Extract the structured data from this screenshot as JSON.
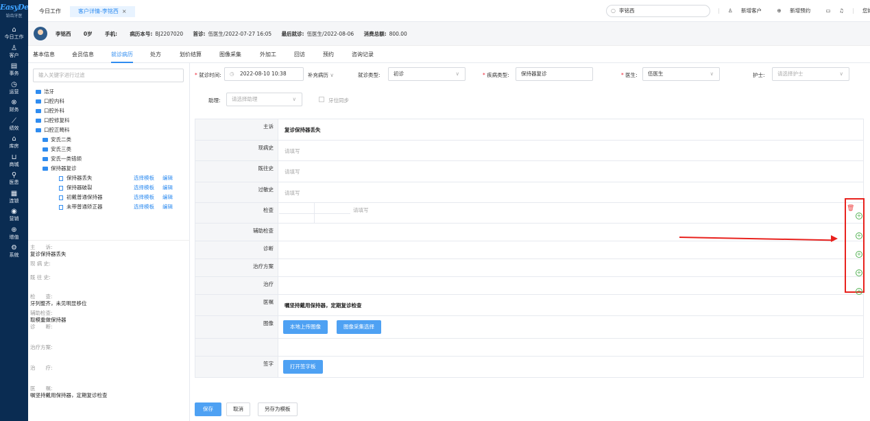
{
  "app": {
    "brand": "EasyDent",
    "brand_sub": "铂齿牙医"
  },
  "nav": [
    {
      "icon": "home-icon",
      "glyph": "⌂",
      "label": "今日工作"
    },
    {
      "icon": "customer-icon",
      "glyph": "♙",
      "label": "客户"
    },
    {
      "icon": "affairs-icon",
      "glyph": "▤",
      "label": "事务"
    },
    {
      "icon": "operation-icon",
      "glyph": "◷",
      "label": "运营"
    },
    {
      "icon": "finance-icon",
      "glyph": "⊗",
      "label": "财务"
    },
    {
      "icon": "performance-icon",
      "glyph": "⟋",
      "label": "绩效"
    },
    {
      "icon": "warehouse-icon",
      "glyph": "⌂",
      "label": "库房"
    },
    {
      "icon": "mall-icon",
      "glyph": "⊔",
      "label": "商城"
    },
    {
      "icon": "medical-icon",
      "glyph": "⚲",
      "label": "医患"
    },
    {
      "icon": "chain-icon",
      "glyph": "▦",
      "label": "连锁"
    },
    {
      "icon": "marketing-icon",
      "glyph": "◉",
      "label": "营销"
    },
    {
      "icon": "value-added-icon",
      "glyph": "⊕",
      "label": "增值"
    },
    {
      "icon": "system-icon",
      "glyph": "⚙",
      "label": "系统"
    }
  ],
  "topbar": {
    "home_tab": "今日工作",
    "active_tab": "客户详情-李铭西",
    "search_value": "李铭西",
    "new_customer": "新增客户",
    "new_appointment": "新增预约",
    "greeting": "您好，超管"
  },
  "patient": {
    "name": "李铭西",
    "age": "0岁",
    "phone_label": "手机:",
    "record_label": "病历本号:",
    "record_no": "BJ2207020",
    "first_label": "首诊:",
    "first_visit": "伍医生/2022-07-27 16:05",
    "last_label": "最后就诊:",
    "last_visit": "伍医生/2022-08-06",
    "total_label": "消费总额:",
    "total": "800.00"
  },
  "subtabs": [
    "基本信息",
    "会员信息",
    "就诊病历",
    "处方",
    "划价结算",
    "图像采集",
    "外加工",
    "回访",
    "预约",
    "咨询记录"
  ],
  "left": {
    "filter_placeholder": "输入关键字进行过滤",
    "tree": [
      {
        "type": "folder",
        "label": "洁牙",
        "indent": 0
      },
      {
        "type": "folder",
        "label": "口腔内科",
        "indent": 0
      },
      {
        "type": "folder",
        "label": "口腔外科",
        "indent": 0
      },
      {
        "type": "folder",
        "label": "口腔修复科",
        "indent": 0
      },
      {
        "type": "folder",
        "label": "口腔正畸科",
        "indent": 0
      },
      {
        "type": "folder",
        "label": "安氏二类",
        "indent": 1
      },
      {
        "type": "folder",
        "label": "安氏三类",
        "indent": 1
      },
      {
        "type": "folder",
        "label": "安氏一类错颌",
        "indent": 1
      },
      {
        "type": "folder",
        "label": "保持器复诊",
        "indent": 1
      },
      {
        "type": "file",
        "label": "保持器丢失",
        "indent": 2
      },
      {
        "type": "file",
        "label": "保持器破裂",
        "indent": 2
      },
      {
        "type": "file",
        "label": "初戴普通保持器",
        "indent": 2
      },
      {
        "type": "file",
        "label": "未带普通矫正器",
        "indent": 2
      }
    ],
    "select_template": "选择模板",
    "edit": "编辑",
    "summary": [
      {
        "label": "主　　诉:",
        "value": "复诊保持器丢失"
      },
      {
        "label": "现 病 史:",
        "value": ""
      },
      {
        "label": "既 往 史:",
        "value": ""
      },
      {
        "label": "检　　查:",
        "value": "牙列整齐，未见明显移位"
      },
      {
        "label": "辅助检查:",
        "value": "取模重做保持器"
      },
      {
        "label": "诊　　断:",
        "value": ""
      },
      {
        "label": "治疗方案:",
        "value": ""
      },
      {
        "label": "治　　疗:",
        "value": ""
      },
      {
        "label": "医　　嘱:",
        "value": "嘱坚持戴用保持器，定期复诊检查"
      }
    ]
  },
  "form": {
    "visit_time_label": "就诊时间:",
    "visit_time": "2022-08-10 10:38",
    "supplement": "补充病历",
    "visit_type_label": "就诊类型:",
    "visit_type": "初诊",
    "disease_type_label": "疾病类型:",
    "disease_type": "保持器复诊",
    "doctor_label": "医生:",
    "doctor": "伍医生",
    "nurse_label": "护士:",
    "nurse_placeholder": "请选择护士",
    "assistant_label": "助理:",
    "assistant_placeholder": "请选择助理",
    "tooth_sync": "牙位同步"
  },
  "record": {
    "placeholder": "请填写",
    "rows": [
      {
        "label": "主诉",
        "value": "复诊保持器丢失"
      },
      {
        "label": "现病史",
        "value": ""
      },
      {
        "label": "既往史",
        "value": ""
      },
      {
        "label": "过敏史",
        "value": ""
      },
      {
        "label": "检查",
        "value": ""
      },
      {
        "label": "辅助检查",
        "value": ""
      },
      {
        "label": "诊断",
        "value": ""
      },
      {
        "label": "治疗方案",
        "value": ""
      },
      {
        "label": "治疗",
        "value": ""
      },
      {
        "label": "医嘱",
        "value": "嘱坚持戴用保持器，定期复诊检查"
      },
      {
        "label": "图像",
        "value": ""
      },
      {
        "label": "",
        "value": ""
      },
      {
        "label": "签字",
        "value": ""
      }
    ],
    "upload_local": "本地上传图像",
    "image_select": "图像采集选择",
    "open_signature": "打开签字板"
  },
  "footer": {
    "save": "保存",
    "cancel": "取消",
    "save_template": "另存为模板"
  },
  "colors": {
    "accent": "#2f8cf0",
    "sidebar": "#0a2c52",
    "annotation": "#e8201c"
  }
}
